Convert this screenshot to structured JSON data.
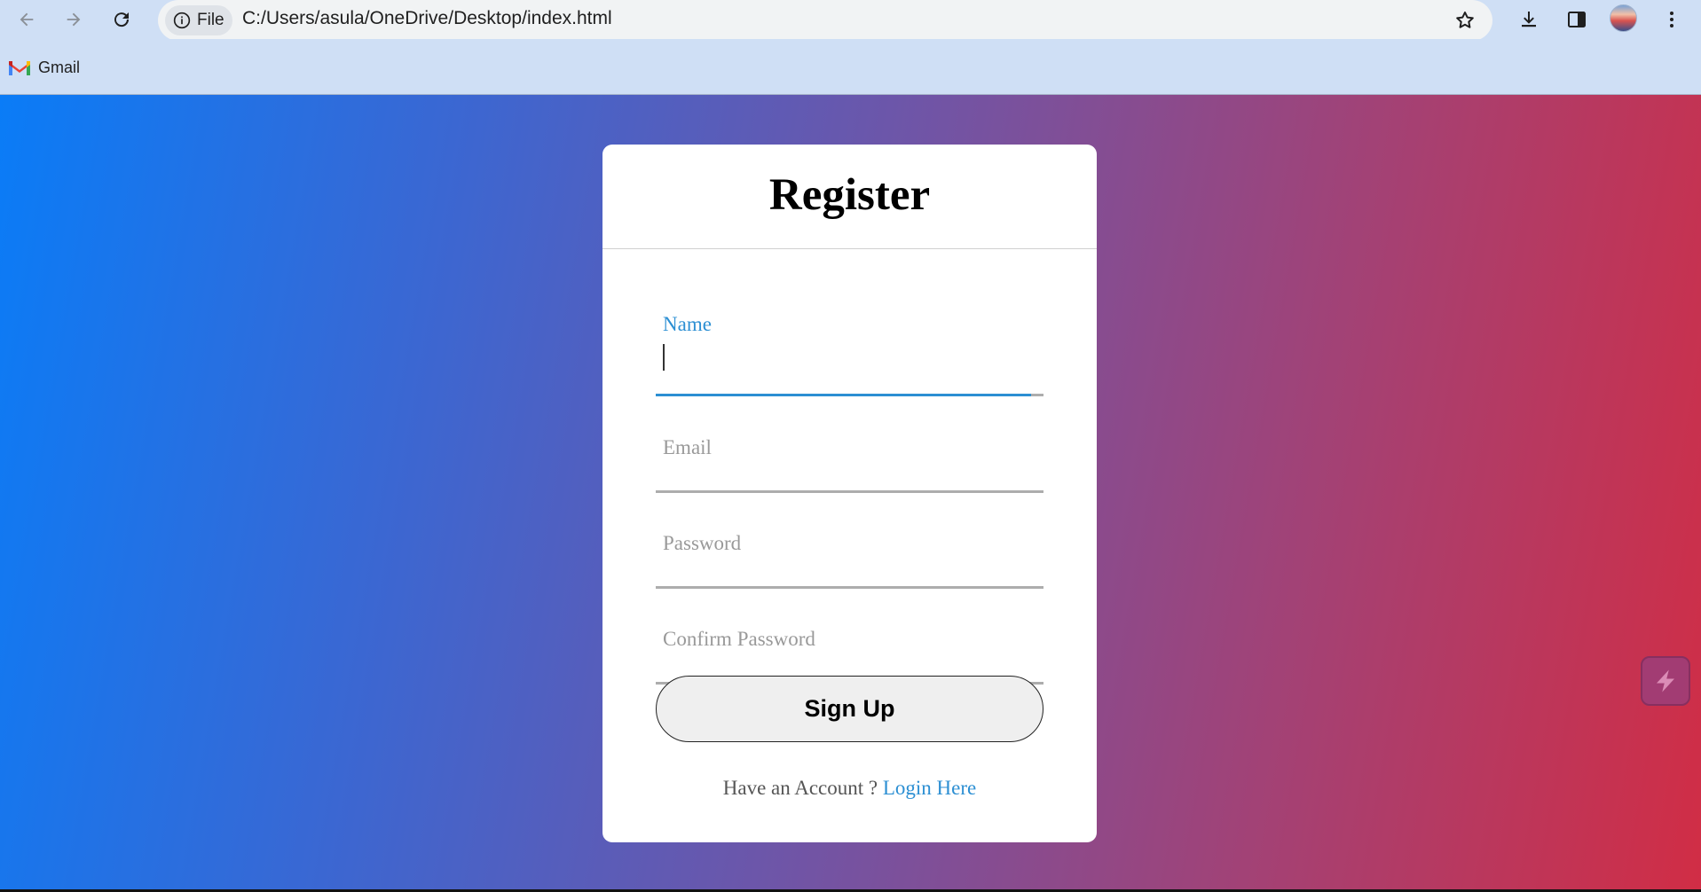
{
  "browser": {
    "site_chip_label": "File",
    "url": "C:/Users/asula/OneDrive/Desktop/index.html",
    "bookmarks": [
      {
        "label": "Gmail",
        "icon": "gmail-icon"
      }
    ],
    "icons": [
      "back-arrow-icon",
      "forward-arrow-icon",
      "reload-icon",
      "info-icon",
      "star-icon",
      "download-icon",
      "side-panel-icon",
      "profile-avatar",
      "more-menu-icon"
    ]
  },
  "form": {
    "title": "Register",
    "fields": [
      {
        "label": "Name",
        "value": "",
        "state": "focused"
      },
      {
        "label": "Email",
        "value": ""
      },
      {
        "label": "Password",
        "value": ""
      },
      {
        "label": "Confirm Password",
        "value": ""
      }
    ],
    "submit_label": "Sign Up",
    "footer_text": "Have an Account ?",
    "footer_link": "Login Here"
  },
  "colors": {
    "gradient_start": "#0a7cf7",
    "gradient_end": "#d12d45",
    "accent": "#2c8fd3",
    "chrome_bg": "#cfdff5"
  },
  "extension_icon": "lightning-extension-icon"
}
